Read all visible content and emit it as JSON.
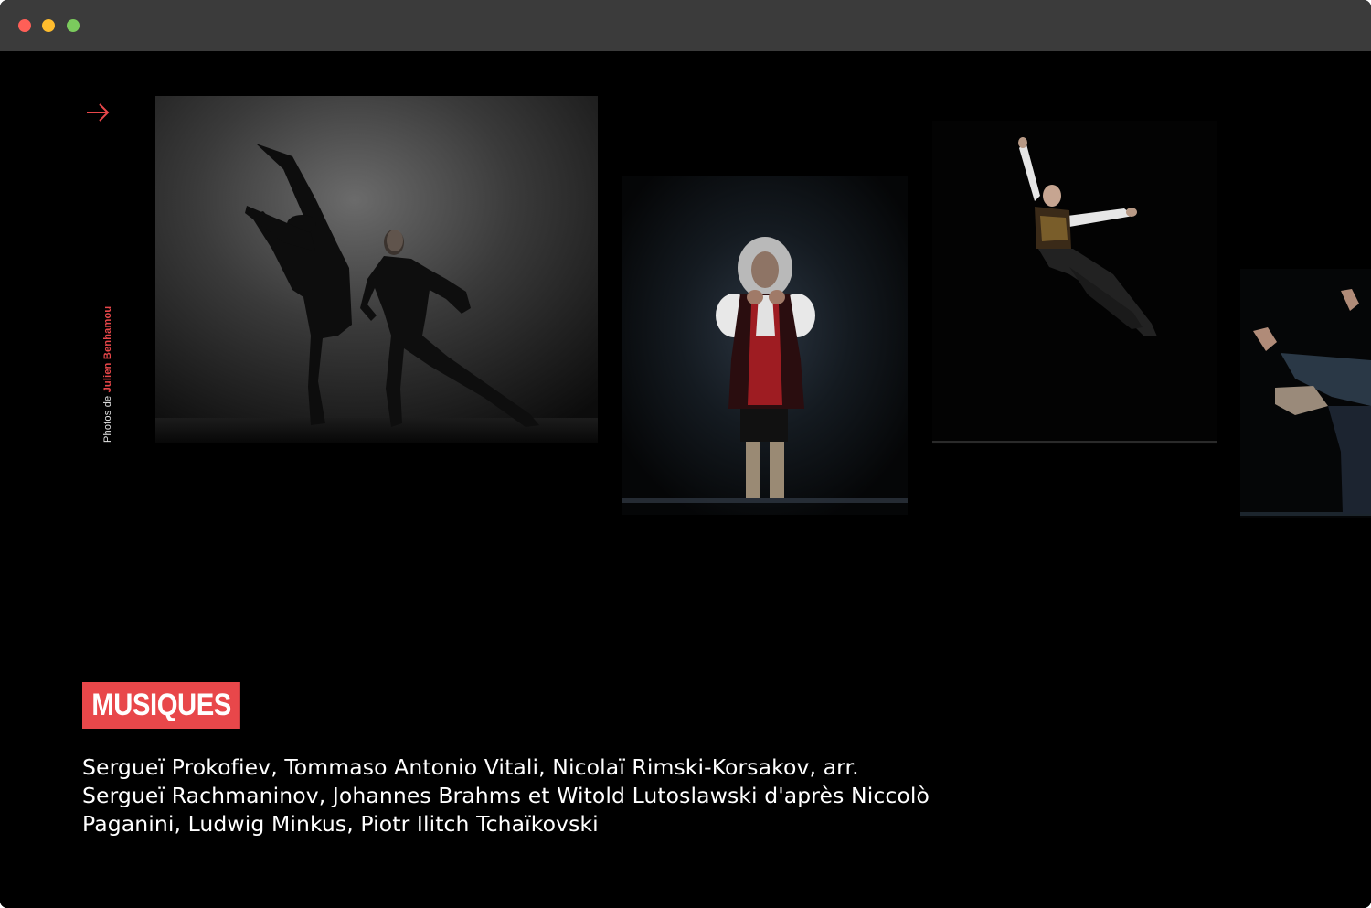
{
  "window": {
    "colors": {
      "close": "#ff5f57",
      "minimize": "#febc2e",
      "zoom": "#28c840",
      "titlebar": "#3b3b3b"
    }
  },
  "nav": {
    "next_icon": "arrow-right-icon",
    "accent": "#e8474a"
  },
  "credit": {
    "prefix": "Photos de",
    "author": "Julien Benhamou"
  },
  "gallery": {
    "photos": [
      {
        "subject": "two dancers in black on misty stage"
      },
      {
        "subject": "performer in baroque wig and red costume"
      },
      {
        "subject": "leaping dancer in embroidered vest"
      },
      {
        "subject": "dancer with outstretched hands, cropped"
      }
    ]
  },
  "musiques": {
    "label": "MUSIQUES",
    "text": "Sergueï Prokofiev, Tommaso Antonio Vitali, Nicolaï Rimski-Korsakov, arr. Sergueï Rachmaninov, Johannes Brahms et Witold Lutoslawski d'après Niccolò Paganini, Ludwig Minkus, Piotr Ilitch Tchaïkovski"
  }
}
